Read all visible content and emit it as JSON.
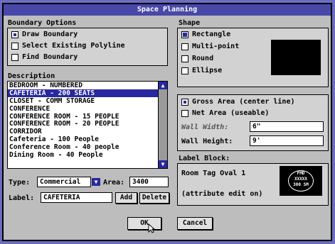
{
  "window": {
    "title": "Space Planning"
  },
  "boundary": {
    "header": "Boundary Options",
    "options": [
      "Draw Boundary",
      "Select Existing Polyline",
      "Find Boundary"
    ]
  },
  "shape": {
    "header": "Shape",
    "options": [
      "Rectangle",
      "Multi-point",
      "Round",
      "Ellipse"
    ],
    "selected": "Rectangle"
  },
  "description": {
    "header": "Description",
    "items": [
      "BEDROOM - NUMBERED",
      "CAFETERIA - 200 SEATS",
      "CLOSET - COMM STORAGE",
      "CONFERENCE",
      "CONFERENCE ROOM - 15 PEOPLE",
      "CONFERENCE ROOM - 20 PEOPLE",
      "CORRIDOR",
      "Cafeteria - 100 People",
      "Conference Room - 40 people",
      "Dining Room - 40 People"
    ],
    "selected": "CAFETERIA - 200 SEATS"
  },
  "type": {
    "label": "Type:",
    "value": "Commercial"
  },
  "area": {
    "label": "Area:",
    "value": "3400"
  },
  "label_field": {
    "label": "Label:",
    "value": "CAFETERIA"
  },
  "buttons": {
    "add": "Add",
    "delete": "Delete",
    "ok": "OK",
    "cancel": "Cancel"
  },
  "area_mode": {
    "options": [
      "Gross Area (center line)",
      "Net Area (useable)"
    ],
    "selected": "Gross Area (center line)"
  },
  "wall_width": {
    "label": "Wall Width:",
    "value": "6\""
  },
  "wall_height": {
    "label": "Wall Height:",
    "value": "9'"
  },
  "label_block": {
    "header": "Label Block:",
    "name": "Room Tag Oval 1",
    "note": "(attribute edit on)",
    "preview_lines": [
      "FMD",
      "XXXXX",
      "300 SM"
    ]
  }
}
